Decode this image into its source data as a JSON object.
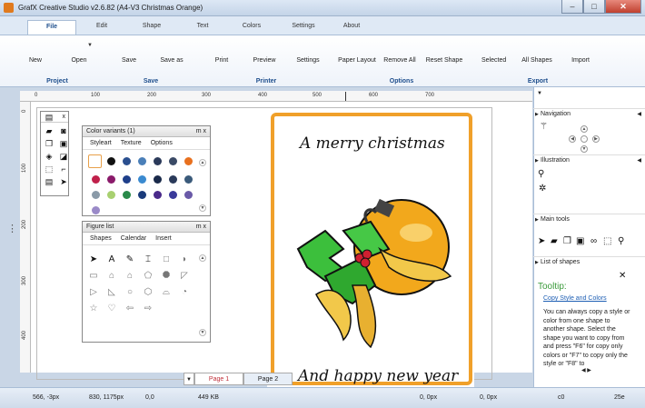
{
  "window": {
    "title": "GrafX Creative Studio v2.6.82 (A4-V3 Christmas Orange)"
  },
  "ribbon": {
    "tabs": [
      "File",
      "Edit",
      "Shape",
      "Text",
      "Colors",
      "Settings",
      "About"
    ],
    "buttons": {
      "new": "New",
      "open": "Open",
      "save": "Save",
      "save_as": "Save as",
      "print": "Print",
      "preview": "Preview",
      "print_settings": "Settings",
      "paper_layout": "Paper Layout",
      "remove_all": "Remove All",
      "reset_shape": "Reset Shape",
      "export_selected": "Selected",
      "export_all": "All Shapes",
      "import": "Import"
    },
    "groups": {
      "project": "Project",
      "save": "Save",
      "printer": "Printer",
      "options": "Options",
      "export": "Export"
    }
  },
  "ruler": {
    "h_ticks": [
      "0",
      "100",
      "200",
      "300",
      "400",
      "500",
      "600",
      "700"
    ],
    "v_ticks": [
      "0",
      "100",
      "200",
      "300",
      "400"
    ]
  },
  "color_panel": {
    "title": "Color variants (1)",
    "controls": "m  x",
    "tabs": [
      "Styleart",
      "Texture",
      "Options"
    ],
    "swatches": [
      "#ffffff",
      "#111111",
      "#2a4f8f",
      "#4a7fb8",
      "#2b3a5a",
      "#3a4a66",
      "#e8701e",
      "#c0204a",
      "#8a1a6a",
      "#1e3f8a",
      "#3a8ad0",
      "#1a2a4a",
      "#2a3a5a",
      "#3a5a7a",
      "#8a9aa8",
      "#a8d070",
      "#2a8a4a",
      "#1a3a7a",
      "#4a2a8a",
      "#3a3a9a",
      "#6a5aa8",
      "#9a8ac8"
    ]
  },
  "figure_panel": {
    "title": "Figure list",
    "controls": "m  x",
    "tabs": [
      "Shapes",
      "Calendar",
      "Insert"
    ]
  },
  "card": {
    "line1": "A merry christmas",
    "line2": "And happy new year"
  },
  "page_tabs": [
    "Page 1",
    "Page 2"
  ],
  "sidebar": {
    "navigation": "Navigation",
    "illustration": "Illustration",
    "main_tools": "Main tools",
    "list_of_shapes": "List of shapes"
  },
  "tooltip": {
    "title": "Tooltip:",
    "link": "Copy Style and Colors",
    "body": "You can always copy a style or color from one shape to another shape. Select the shape you want to copy from and press \"F6\" for copy only colors or \"F7\" to copy only the style or \"F8\" to"
  },
  "status": {
    "cursor": "566, -3px",
    "size": "830, 1175px",
    "origin": "0,0",
    "filesize": "449 KB",
    "pos2": "0, 0px",
    "pos3": "0, 0px",
    "c": "c0",
    "z": "25e"
  },
  "colors": {
    "accent": "#1e4e8c",
    "card_border": "#f0a02a",
    "tooltip_title": "#3a9a3a"
  }
}
